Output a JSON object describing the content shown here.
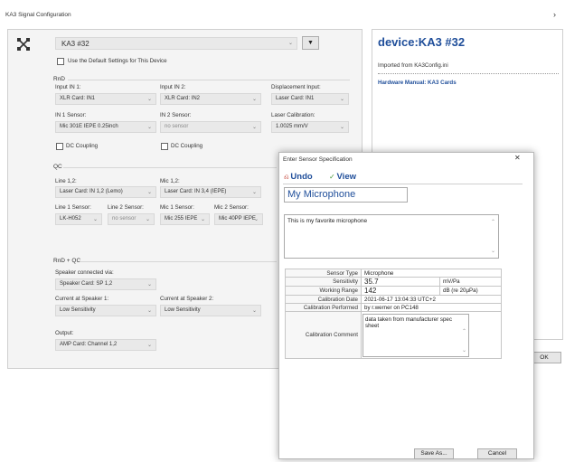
{
  "main_window": {
    "title": "KA3 Signal Configuration",
    "close_glyph": "›",
    "device_select": "KA3 #32",
    "use_default_label": "Use the Default Settings for This Device",
    "rnd": {
      "heading": "RnD",
      "input1_label": "Input IN 1:",
      "input1_value": "XLR Card: IN1",
      "input2_label": "Input IN 2:",
      "input2_value": "XLR Card: IN2",
      "disp_label": "Displacement Input:",
      "disp_value": "Laser Card: IN1",
      "sensor1_label": "IN 1 Sensor:",
      "sensor1_value": "Mic 301E IEPE 0.25inch",
      "sensor2_label": "IN 2 Sensor:",
      "sensor2_value": "no sensor",
      "laser_cal_label": "Laser Calibration:",
      "laser_cal_value": "1.0025 mm/V",
      "dc1_label": "DC Coupling",
      "dc2_label": "DC Coupling"
    },
    "qc": {
      "heading": "QC",
      "line_label": "Line 1,2:",
      "line_value": "Laser Card: IN 1,2 (Lemo)",
      "mic_label": "Mic 1,2:",
      "mic_value": "Laser Card: IN 3,4 (IEPE)",
      "line1_sensor_label": "Line 1 Sensor:",
      "line1_sensor_value": "LK-H052",
      "line2_sensor_label": "Line 2 Sensor:",
      "line2_sensor_value": "no sensor",
      "mic1_sensor_label": "Mic 1 Sensor:",
      "mic1_sensor_value": "Mic 255 IEPE",
      "mic2_sensor_label": "Mic 2 Sensor:",
      "mic2_sensor_value": "Mic 40PP IEPE"
    },
    "rndqc": {
      "heading": "RnD + QC",
      "speaker_label": "Speaker connected via:",
      "speaker_value": "Speaker Card: SP 1,2",
      "current1_label": "Current at Speaker 1:",
      "current1_value": "Low Sensitivity",
      "current2_label": "Current at Speaker 2:",
      "current2_value": "Low Sensitivity",
      "output_label": "Output:",
      "output_value": "AMP Card: Channel 1,2"
    },
    "info": {
      "device_title": "device:KA3 #32",
      "imported": "Imported from KA3Config.ini",
      "manual_link": "Hardware Manual: KA3 Cards"
    },
    "ok_label": "OK",
    "dropdown_arrow": "▼"
  },
  "dialog": {
    "title": "Enter Sensor Specification",
    "close_glyph": "✕",
    "undo_label": "Undo",
    "view_label": "View",
    "name_value": "My Microphone",
    "description": "This is my favorite microphone",
    "props": {
      "sensor_type_key": "Sensor Type",
      "sensor_type_val": "Microphone",
      "sensitivity_key": "Sensitivity",
      "sensitivity_val": "35.7",
      "sensitivity_unit": "mV/Pa",
      "range_key": "Working Range",
      "range_val": "142",
      "range_unit": "dB (re 20µPa)",
      "cal_date_key": "Calibration Date",
      "cal_date_val": "2021-06-17  13:04:33 UTC+2",
      "cal_by_key": "Calibration Performed",
      "cal_by_val": "by r.werner on PC148",
      "comment_key": "Calibration Comment",
      "comment_val": "data taken from manufacturer spec sheet"
    },
    "save_label": "Save As...",
    "cancel_label": "Cancel"
  },
  "colors": {
    "accent": "#1f4e9a",
    "undo_red": "#c0392b",
    "view_green": "#4a9a3a"
  }
}
